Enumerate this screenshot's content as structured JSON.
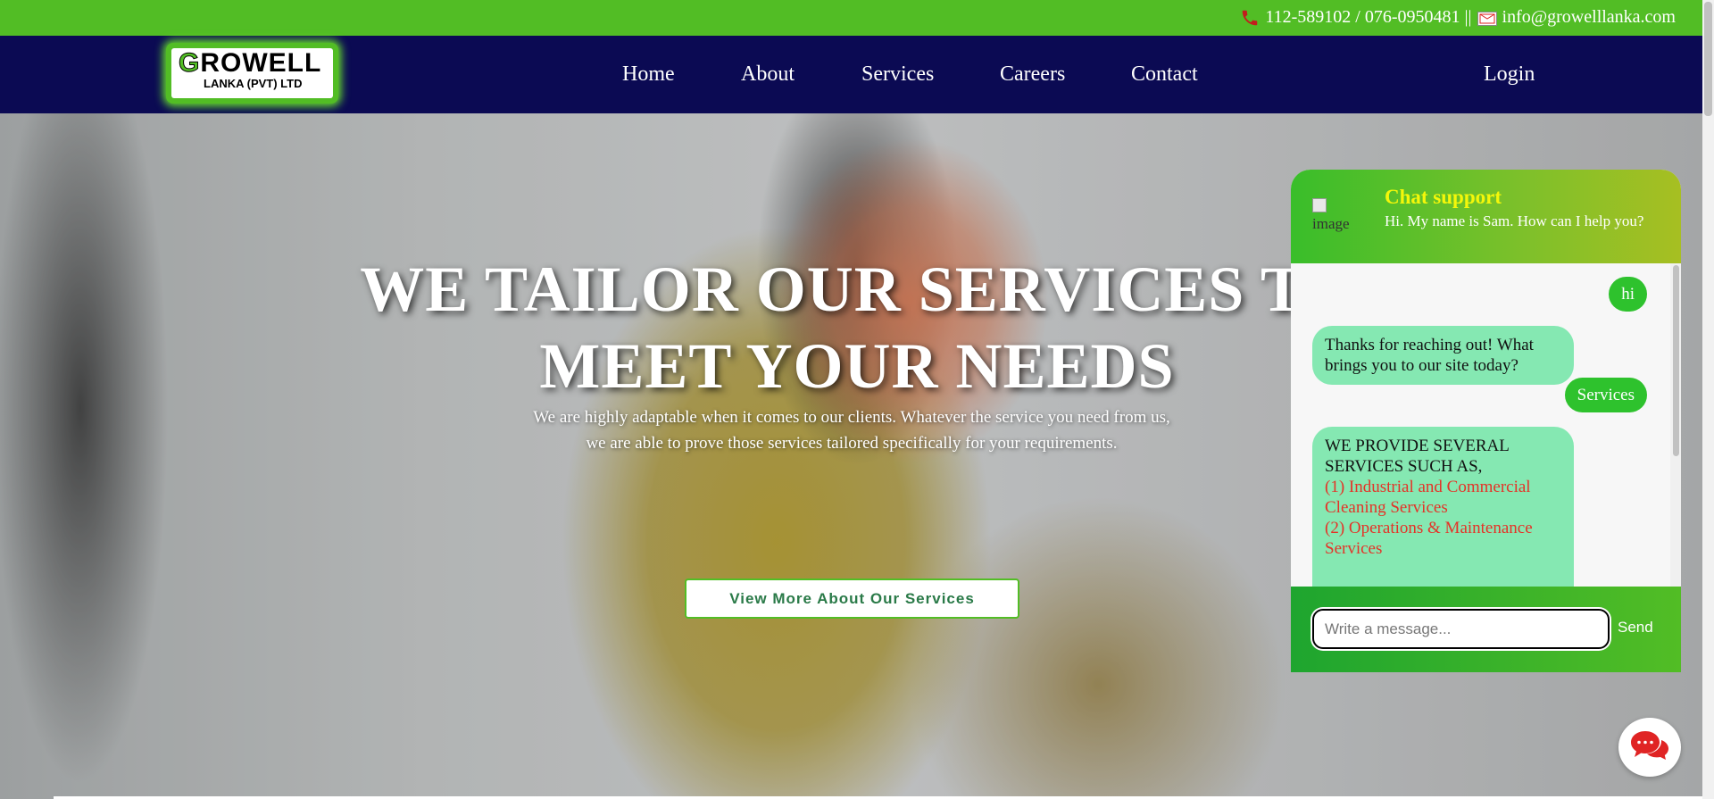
{
  "topbar": {
    "phones": "112-589102 / 076-0950481 ||",
    "email": "info@growelllanka.com",
    "icons": [
      "phone-icon",
      "mail-icon"
    ]
  },
  "logo": {
    "title_main": "ROWELL",
    "title_initial": "G",
    "subtitle": "LANKA (PVT) LTD"
  },
  "nav": {
    "items": [
      {
        "label": "Home"
      },
      {
        "label": "About"
      },
      {
        "label": "Services"
      },
      {
        "label": "Careers"
      },
      {
        "label": "Contact"
      }
    ],
    "login": "Login"
  },
  "hero": {
    "title_line1": "WE TAILOR OUR SERVICES TO",
    "title_line2": "MEET YOUR NEEDS",
    "subtitle_line1": "We are highly adaptable when it comes to our clients. Whatever the service you need from us,",
    "subtitle_line2": "we are able to prove those services tailored specifically for your requirements.",
    "button": "View More About Our Services"
  },
  "chat": {
    "title": "Chat support",
    "greeting": "Hi. My name is Sam. How can I help you?",
    "avatar_alt": "image",
    "messages": [
      {
        "from": "user",
        "text": "hi"
      },
      {
        "from": "bot",
        "text": "Thanks for reaching out! What brings you to our site today?"
      },
      {
        "from": "user",
        "text": "Services"
      },
      {
        "from": "bot",
        "intro": "WE PROVIDE SEVERAL SERVICES SUCH AS,",
        "items": [
          "(1) Industrial and Commercial Cleaning Services",
          "(2) Operations & Maintenance Services"
        ]
      }
    ],
    "input_placeholder": "Write a message...",
    "send": "Send"
  },
  "colors": {
    "topbar": "#52bd25",
    "nav": "#0b0a53",
    "chat_title": "#f4f70a",
    "bot_bubble": "#85e8b2",
    "user_bubble": "#2ec22d",
    "service_item": "#e53227",
    "fab_icon": "#e02424"
  }
}
